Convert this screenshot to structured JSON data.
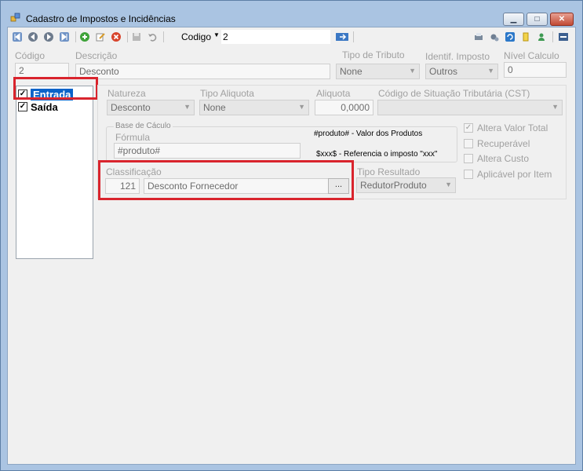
{
  "window": {
    "title": "Cadastro de Impostos e Incidências",
    "minimize": "▁",
    "maximize": "□",
    "close": "✕"
  },
  "toolbar": {
    "field_label": "Codigo",
    "caret": "▼",
    "field_value": "2"
  },
  "header": {
    "codigo_label": "Código",
    "codigo_value": "2",
    "descricao_label": "Descrição",
    "descricao_value": "Desconto",
    "tipo_tributo_label": "Tipo de Tributo",
    "tipo_tributo_value": "None",
    "identif_label": "Identif. Imposto",
    "identif_value": "Outros",
    "nivel_label": "Nível Calculo",
    "nivel_value": "0"
  },
  "list": {
    "items": [
      {
        "label": "Entrada",
        "checked": "✓"
      },
      {
        "label": "Saída",
        "checked": "✓"
      }
    ]
  },
  "detail": {
    "natureza_label": "Natureza",
    "natureza_value": "Desconto",
    "tipo_aliquota_label": "Tipo Aliquota",
    "tipo_aliquota_value": "None",
    "aliquota_label": "Aliquota",
    "aliquota_value": "0,0000",
    "cst_label": "Código de Situação Tributária (CST)",
    "cst_value": "",
    "base_calculo_label": "Base de Cáculo",
    "formula_label": "Fórmula",
    "formula_value": "#produto#",
    "hint_1": "#produto# - Valor dos Produtos",
    "hint_2": "$xxx$ - Referencia o imposto \"xxx\"",
    "classificacao_label": "Classificação",
    "classificacao_code": "121",
    "classificacao_value": "Desconto Fornecedor",
    "dots": "...",
    "tipo_resultado_label": "Tipo Resultado",
    "tipo_resultado_value": "RedutorProduto",
    "checks": [
      {
        "label": "Altera Valor Total",
        "mark": "✓"
      },
      {
        "label": "Recuperável",
        "mark": ""
      },
      {
        "label": "Altera Custo",
        "mark": ""
      },
      {
        "label": "Aplicável por Item",
        "mark": ""
      }
    ]
  },
  "colors": {
    "highlight_box": "#d9242d",
    "selection": "#0a63c9",
    "frame": "#aac4e2"
  }
}
